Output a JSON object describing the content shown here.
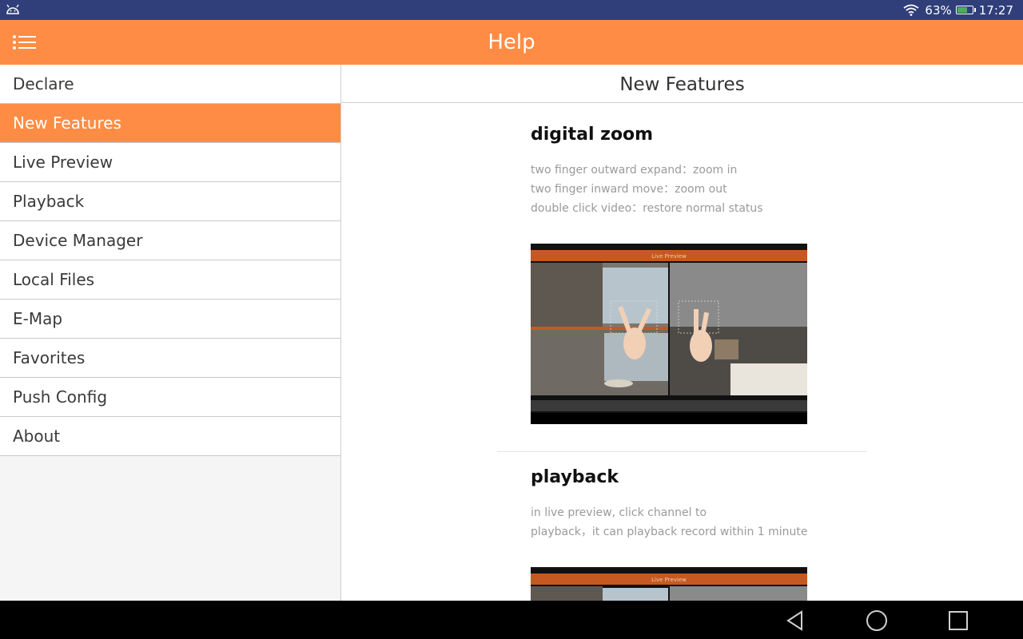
{
  "status_bar": {
    "battery_text": "63%",
    "time": "17:27"
  },
  "app_bar": {
    "title": "Help",
    "menu_icon": "list-menu-icon",
    "color": "#ff8c45"
  },
  "sidebar": {
    "items": [
      {
        "label": "Declare",
        "active": false
      },
      {
        "label": "New Features",
        "active": true
      },
      {
        "label": "Live Preview",
        "active": false
      },
      {
        "label": "Playback",
        "active": false
      },
      {
        "label": "Device Manager",
        "active": false
      },
      {
        "label": "Local Files",
        "active": false
      },
      {
        "label": "E-Map",
        "active": false
      },
      {
        "label": "Favorites",
        "active": false
      },
      {
        "label": "Push Config",
        "active": false
      },
      {
        "label": "About",
        "active": false
      }
    ]
  },
  "content": {
    "header": "New Features",
    "sections": [
      {
        "title": "digital zoom",
        "lines": [
          "two finger outward expand：zoom in",
          "two finger inward move：zoom out",
          "double click video：restore normal status"
        ],
        "screenshot_title": "Live Preview"
      },
      {
        "title": "playback",
        "lines": [
          "in live preview, click channel to",
          "playback，it can playback record within 1 minute"
        ],
        "screenshot_title": "Live Preview"
      }
    ]
  },
  "nav_bar": {
    "buttons": [
      "back-icon",
      "home-icon",
      "recents-icon"
    ]
  }
}
